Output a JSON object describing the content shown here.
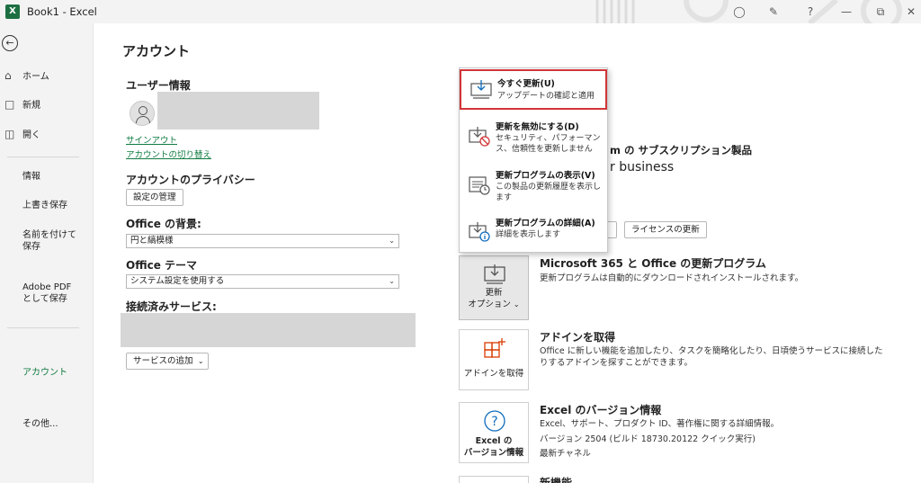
{
  "window": {
    "title": "Book1  -  Excel",
    "logo": "X"
  },
  "nav": {
    "items": [
      {
        "label": "ホーム",
        "icon": "home-icon"
      },
      {
        "label": "新規",
        "icon": "new-document-icon"
      },
      {
        "label": "開く",
        "icon": "folder-open-icon"
      },
      {
        "label": "情報"
      },
      {
        "label": "上書き保存"
      },
      {
        "label": "名前を付けて保存"
      },
      {
        "label": "Adobe PDF として保存"
      },
      {
        "label": "アカウント"
      },
      {
        "label": "その他..."
      }
    ]
  },
  "page": {
    "title": "アカウント"
  },
  "user": {
    "heading": "ユーザー情報",
    "signout": "サインアウト",
    "switch_account": "アカウントの切り替え"
  },
  "privacy": {
    "heading": "アカウントのプライバシー",
    "button": "設定の管理"
  },
  "background": {
    "heading": "Office の背景:",
    "value": "円と縞模様"
  },
  "theme": {
    "heading": "Office テーマ",
    "value": "システム設定を使用する"
  },
  "services": {
    "heading": "接続済みサービス:",
    "add_button": "サービスの追加"
  },
  "subscription": {
    "partial_title": "m の サブスクリプション製品",
    "partial_name": "r business",
    "license_button": "ライセンスの更新"
  },
  "updates": {
    "tile_label_1": "更新",
    "tile_label_2": "オプション",
    "title": "Microsoft 365 と Office の更新プログラム",
    "desc": "更新プログラムは自動的にダウンロードされインストールされます。"
  },
  "addins": {
    "tile_label": "アドインを取得",
    "title": "アドインを取得",
    "desc_1": "Office に新しい機能を追加したり、タスクを簡略化したり、日頃使うサービスに接続した",
    "desc_2": "りするアドインを探すことができます。"
  },
  "version": {
    "tile_label_1": "Excel の",
    "tile_label_2": "バージョン情報",
    "title": "Excel のバージョン情報",
    "line1": "Excel、サポート、プロダクト ID、著作権に関する詳細情報。",
    "line2": "バージョン 2504 (ビルド 18730.20122 クイック実行)",
    "line3": "最新チャネル"
  },
  "new_features": {
    "title": "新機能"
  },
  "update_menu": {
    "items": [
      {
        "title": "今すぐ更新(U)",
        "desc": "アップデートの確認と適用",
        "icon": "update-now-icon"
      },
      {
        "title": "更新を無効にする(D)",
        "desc": "セキュリティ、パフォーマンス、信頼性を更新しません",
        "icon": "disable-updates-icon"
      },
      {
        "title": "更新プログラムの表示(V)",
        "desc": "この製品の更新履歴を表示します",
        "icon": "view-updates-icon"
      },
      {
        "title": "更新プログラムの詳細(A)",
        "desc": "詳細を表示します",
        "icon": "update-info-icon"
      }
    ]
  },
  "colors": {
    "accent": "#107c41",
    "highlight": "#d13438",
    "excel": "#1d6f42"
  }
}
